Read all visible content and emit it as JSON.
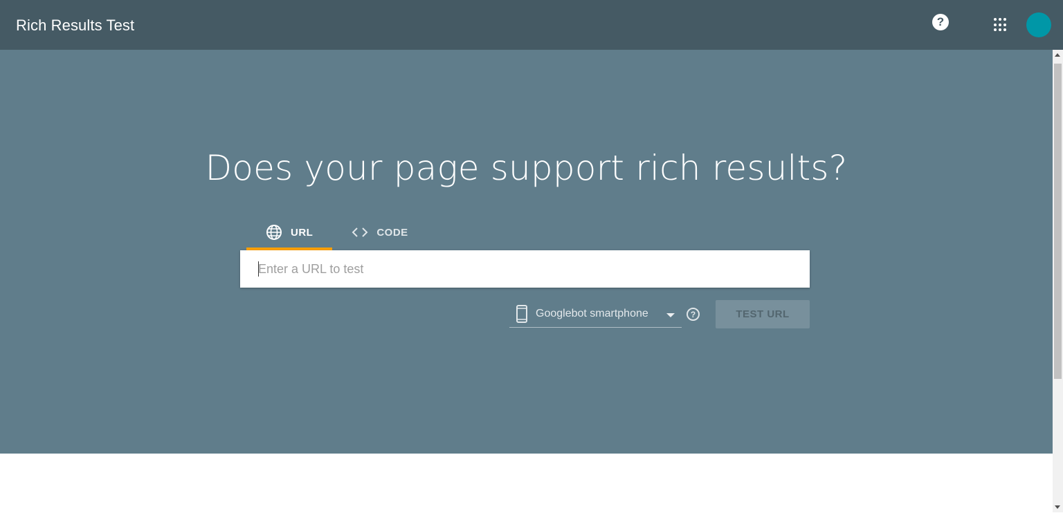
{
  "header": {
    "title": "Rich Results Test",
    "help_icon": "help-circle-icon",
    "help_glyph": "?",
    "apps_icon": "apps-grid-icon",
    "avatar_color": "#0097a7",
    "bar_color": "#455a64"
  },
  "hero": {
    "headline": "Does your page support rich results?",
    "background": "#607d8b",
    "tabs": [
      {
        "label": "URL",
        "icon": "globe-icon",
        "active": true
      },
      {
        "label": "CODE",
        "icon": "code-brackets-icon",
        "active": false
      }
    ],
    "url_input": {
      "placeholder": "Enter a URL to test",
      "value": ""
    },
    "user_agent": {
      "icon": "smartphone-icon",
      "selected": "Googlebot smartphone",
      "dropdown_icon": "chevron-down-icon",
      "help_icon": "help-outline-icon",
      "help_glyph": "?"
    },
    "test_button": {
      "label": "TEST URL",
      "enabled": false
    },
    "accent_color": "#ffa000"
  }
}
